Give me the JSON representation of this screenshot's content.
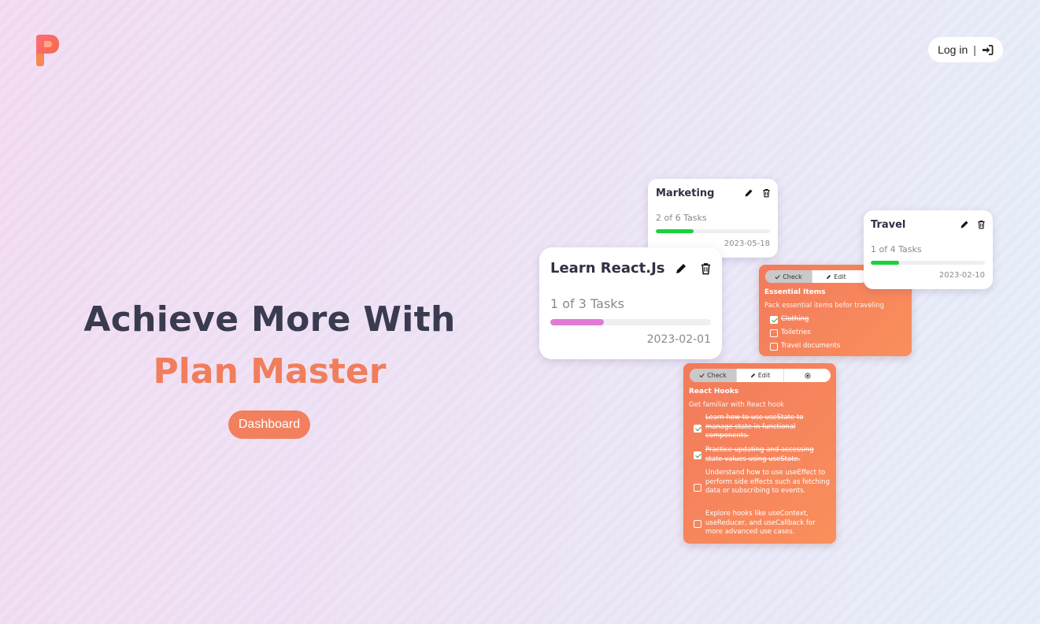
{
  "header": {
    "login_label": "Log in",
    "separator": "|"
  },
  "hero": {
    "line1": "Achieve More With",
    "line2": "Plan Master",
    "cta_label": "Dashboard"
  },
  "colors": {
    "accent": "#f07e5c",
    "title": "#3a3b50",
    "progress_green": "#18d23a",
    "progress_pink": "#e07ad6"
  },
  "cards": {
    "marketing": {
      "title": "Marketing",
      "count": "2 of 6 Tasks",
      "date": "2023-05-18",
      "progress": 0.333
    },
    "react": {
      "title": "Learn React.Js",
      "count": "1 of 3 Tasks",
      "date": "2023-02-01",
      "progress": 0.333
    },
    "travel": {
      "title": "Travel",
      "count": "1 of 4 Tasks",
      "date": "2023-02-10",
      "progress": 0.25
    }
  },
  "panels": {
    "seg_check": "Check",
    "seg_edit": "Edit",
    "essentials": {
      "title": "Essential Items",
      "desc": "Pack essential items befor traveling",
      "items": [
        {
          "text": "Clothing",
          "done": true
        },
        {
          "text": "Toiletries",
          "done": false
        },
        {
          "text": "Travel documents",
          "done": false
        }
      ]
    },
    "hooks": {
      "title": "React Hooks",
      "desc": "Get familiar with React hook",
      "items": [
        {
          "text": "Learn how to use useState to manage state in functional components.",
          "done": true
        },
        {
          "text": "Practice updating and accessing state values using useState.",
          "done": true
        },
        {
          "text": "Understand how to use useEffect to perform side effects such as fetching data or subscribing to events.",
          "done": false
        },
        {
          "text": "Explore hooks like useContext, useReducer, and useCallback for more advanced use cases.",
          "done": false
        }
      ]
    }
  },
  "icons": [
    "logo-icon",
    "login-arrow-icon",
    "pencil-icon",
    "trash-icon",
    "check-icon",
    "target-icon"
  ]
}
